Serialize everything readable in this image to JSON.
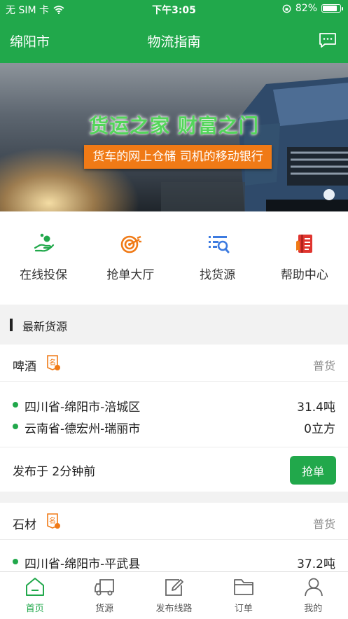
{
  "status_bar": {
    "carrier": "无 SIM 卡",
    "time": "下午3:05",
    "battery": "82%",
    "battery_level": 0.82
  },
  "nav": {
    "city": "绵阳市",
    "title": "物流指南",
    "message_icon": "message-icon"
  },
  "banner": {
    "headline": "货运之家 财富之门",
    "tagline": "货车的网上仓储 司机的移动银行"
  },
  "quick_links": [
    {
      "label": "在线投保",
      "icon": "insurance-hand-icon"
    },
    {
      "label": "抢单大厅",
      "icon": "target-icon"
    },
    {
      "label": "找货源",
      "icon": "search-list-icon"
    },
    {
      "label": "帮助中心",
      "icon": "help-book-icon"
    }
  ],
  "section": {
    "title": "最新货源"
  },
  "cargo": [
    {
      "name": "啤酒",
      "badge": "名",
      "type": "普货",
      "routes": [
        {
          "place": "四川省-绵阳市-涪城区",
          "qty": "31.4吨"
        },
        {
          "place": "云南省-德宏州-瑞丽市",
          "qty": "0立方"
        }
      ],
      "posted": "发布于 2分钟前",
      "action": "抢单"
    },
    {
      "name": "石材",
      "badge": "名",
      "type": "普货",
      "routes": [
        {
          "place": "四川省-绵阳市-平武县",
          "qty": "37.2吨"
        }
      ]
    }
  ],
  "tabs": [
    {
      "label": "首页",
      "icon": "home-icon",
      "active": true
    },
    {
      "label": "货源",
      "icon": "truck-icon",
      "active": false
    },
    {
      "label": "发布线路",
      "icon": "edit-icon",
      "active": false
    },
    {
      "label": "订单",
      "icon": "folder-icon",
      "active": false
    },
    {
      "label": "我的",
      "icon": "user-icon",
      "active": false
    }
  ],
  "colors": {
    "brand_green": "#21a84b",
    "banner_orange": "#f07a16",
    "badge_orange": "#f07a16"
  }
}
